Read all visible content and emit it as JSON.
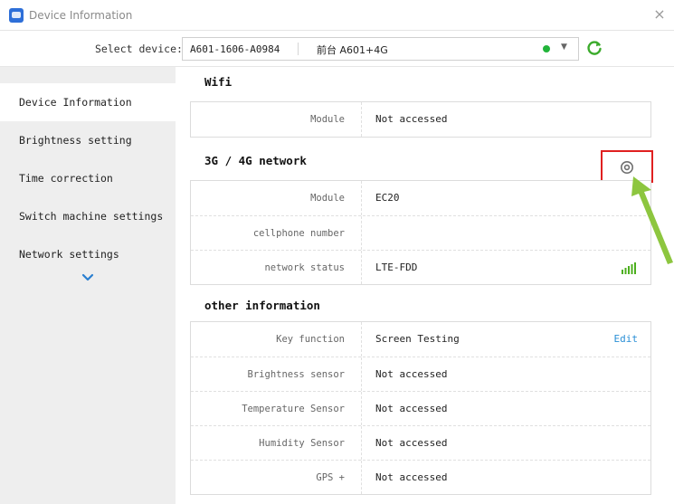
{
  "window": {
    "title": "Device Information",
    "close_label": "×"
  },
  "selector": {
    "label": "Select device:",
    "device_id": "A601-1606-A0984",
    "device_name": "前台 A601+4G",
    "status_color": "#22b43a"
  },
  "sidebar": {
    "items": [
      {
        "label": "Device Information"
      },
      {
        "label": "Brightness setting"
      },
      {
        "label": "Time correction"
      },
      {
        "label": "Switch machine settings"
      },
      {
        "label": "Network settings"
      }
    ]
  },
  "wifi": {
    "title": "Wifi",
    "rows": [
      {
        "label": "Module",
        "value": "Not accessed"
      }
    ]
  },
  "network": {
    "title": "3G / 4G network",
    "rows": [
      {
        "label": "Module",
        "value": "EC20"
      },
      {
        "label": "cellphone number",
        "value": ""
      },
      {
        "label": "network status",
        "value": "LTE-FDD"
      }
    ]
  },
  "other": {
    "title": "other information",
    "edit_label": "Edit",
    "rows": [
      {
        "label": "Key function",
        "value": "Screen Testing"
      },
      {
        "label": "Brightness sensor",
        "value": "Not accessed"
      },
      {
        "label": "Temperature Sensor",
        "value": "Not accessed"
      },
      {
        "label": "Humidity Sensor",
        "value": "Not accessed"
      },
      {
        "label": "GPS +",
        "value": "Not accessed"
      }
    ]
  },
  "icons": {
    "app": "app-icon",
    "refresh": "refresh-icon",
    "gear": "gear-icon",
    "signal": "signal-bars-icon",
    "more": "chevron-down-icon"
  },
  "colors": {
    "accent": "#2a8fd6",
    "signal": "#4caf1e",
    "highlight_box": "#e02020",
    "arrow": "#8dc63f"
  }
}
